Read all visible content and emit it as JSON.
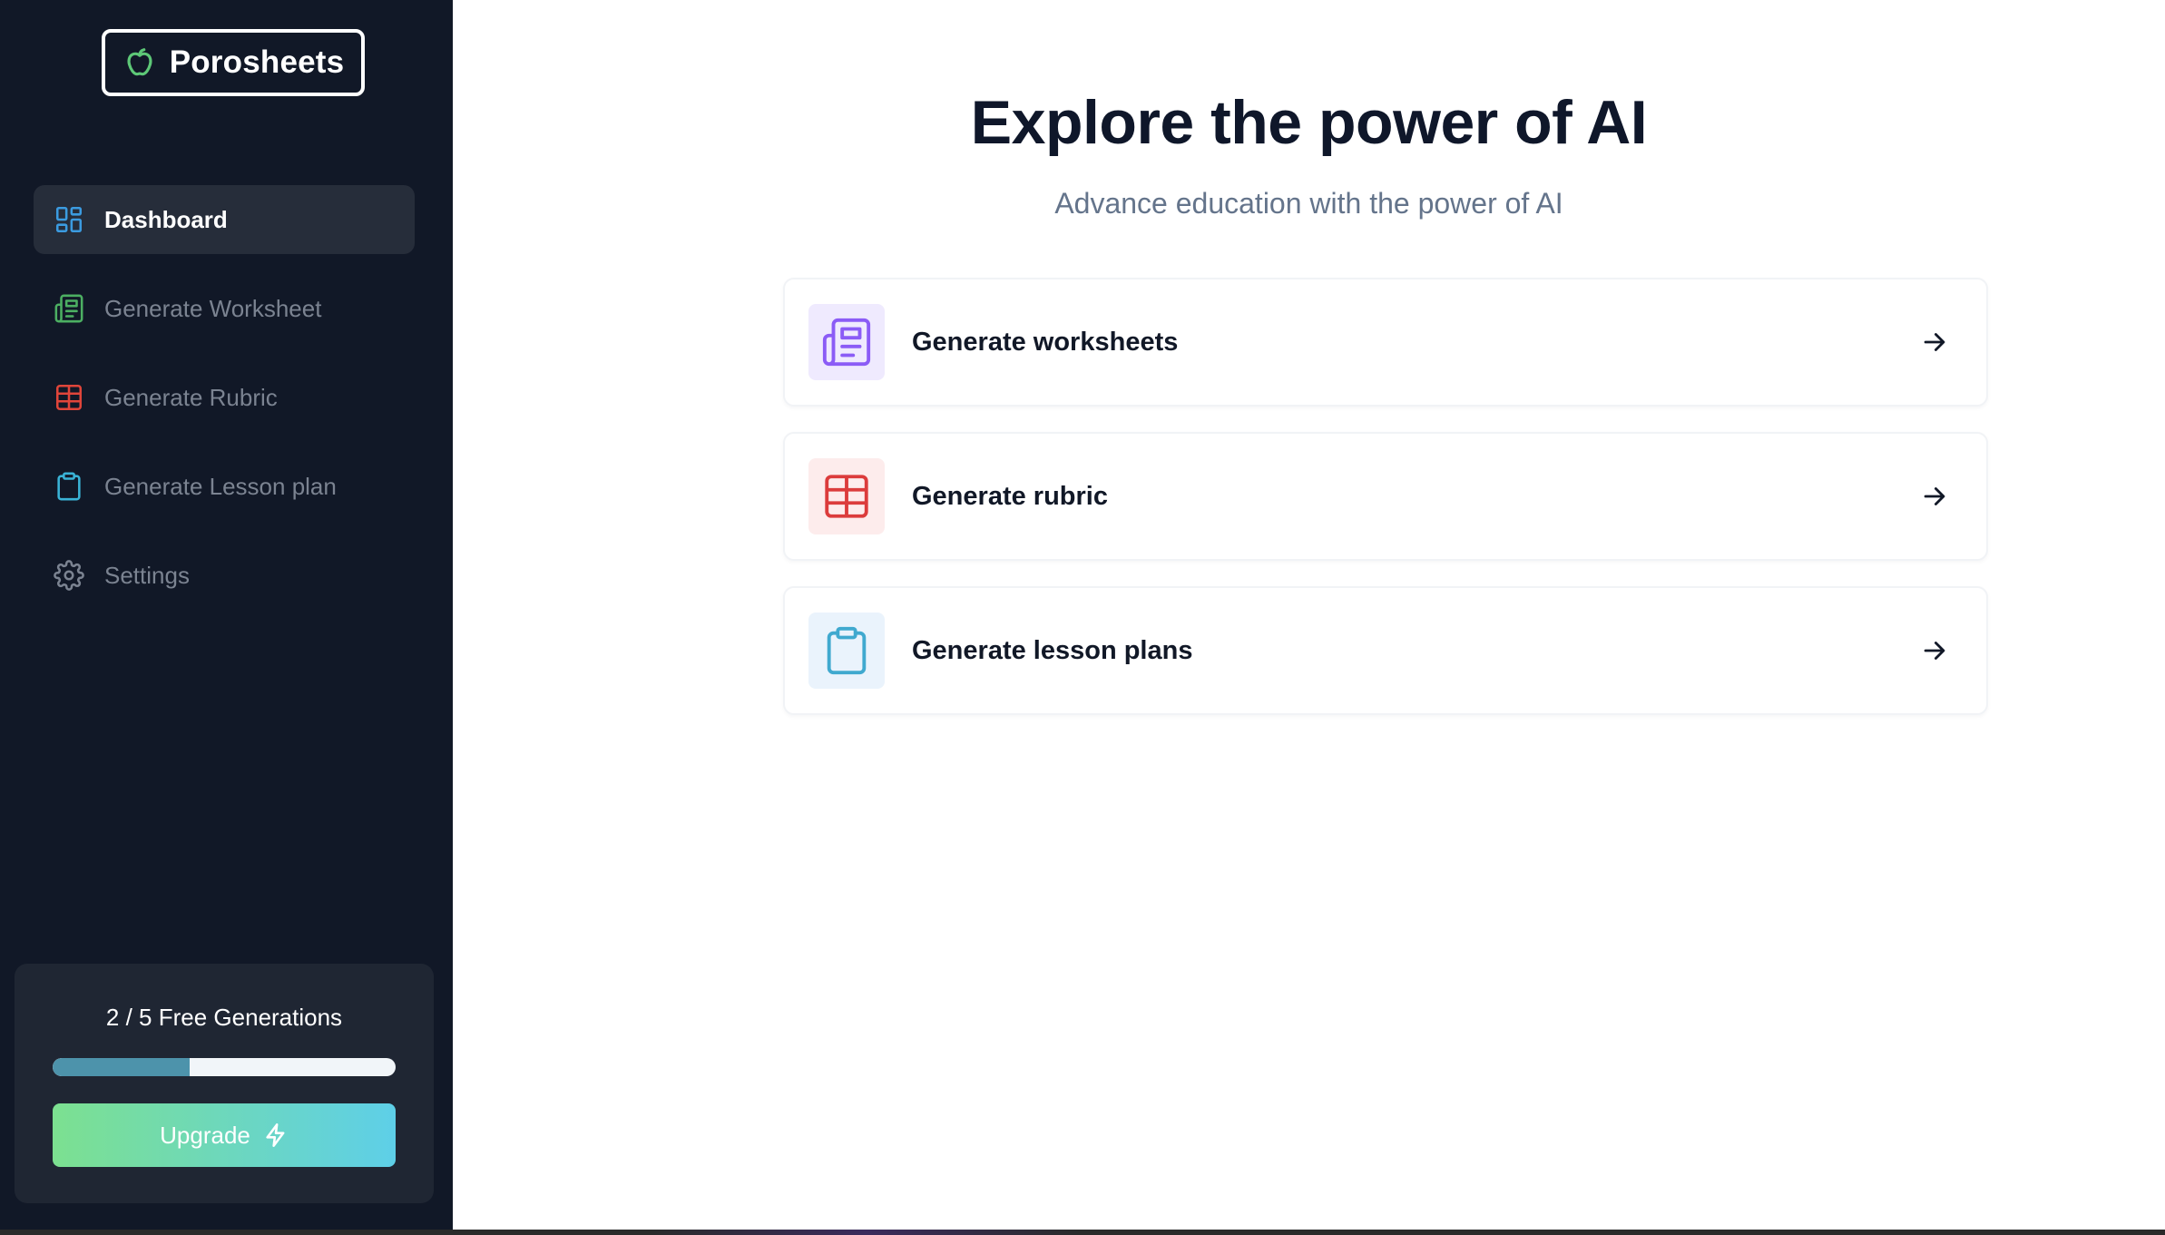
{
  "brand": {
    "name": "Porosheets",
    "icon": "apple-icon",
    "icon_color": "#5dc877"
  },
  "sidebar": {
    "items": [
      {
        "label": "Dashboard",
        "icon": "dashboard-icon",
        "icon_color": "#3b9be0",
        "active": true
      },
      {
        "label": "Generate Worksheet",
        "icon": "newspaper-icon",
        "icon_color": "#4caf62",
        "active": false
      },
      {
        "label": "Generate Rubric",
        "icon": "table-icon",
        "icon_color": "#e0453a",
        "active": false
      },
      {
        "label": "Generate Lesson plan",
        "icon": "clipboard-icon",
        "icon_color": "#3ab3d6",
        "active": false
      },
      {
        "label": "Settings",
        "icon": "gear-icon",
        "icon_color": "#7b8391",
        "active": false
      }
    ]
  },
  "usage": {
    "text": "2 / 5 Free Generations",
    "used": 2,
    "total": 5,
    "upgrade_label": "Upgrade",
    "upgrade_icon": "bolt-icon"
  },
  "main": {
    "title": "Explore the power of AI",
    "subtitle": "Advance education with the power of AI",
    "cards": [
      {
        "label": "Generate worksheets",
        "icon": "newspaper-icon",
        "icon_color": "#8b5cf6",
        "icon_bg": "#efeafe"
      },
      {
        "label": "Generate rubric",
        "icon": "table-icon",
        "icon_color": "#dc3c3c",
        "icon_bg": "#fdecec"
      },
      {
        "label": "Generate lesson plans",
        "icon": "clipboard-icon",
        "icon_color": "#40a9cf",
        "icon_bg": "#eaf3fc"
      }
    ]
  },
  "colors": {
    "sidebar_bg": "#111827",
    "active_item_bg": "#262d3a",
    "progress_fill": "#4d93ab",
    "upgrade_gradient_start": "#7ce090",
    "upgrade_gradient_end": "#5ecfe8"
  }
}
